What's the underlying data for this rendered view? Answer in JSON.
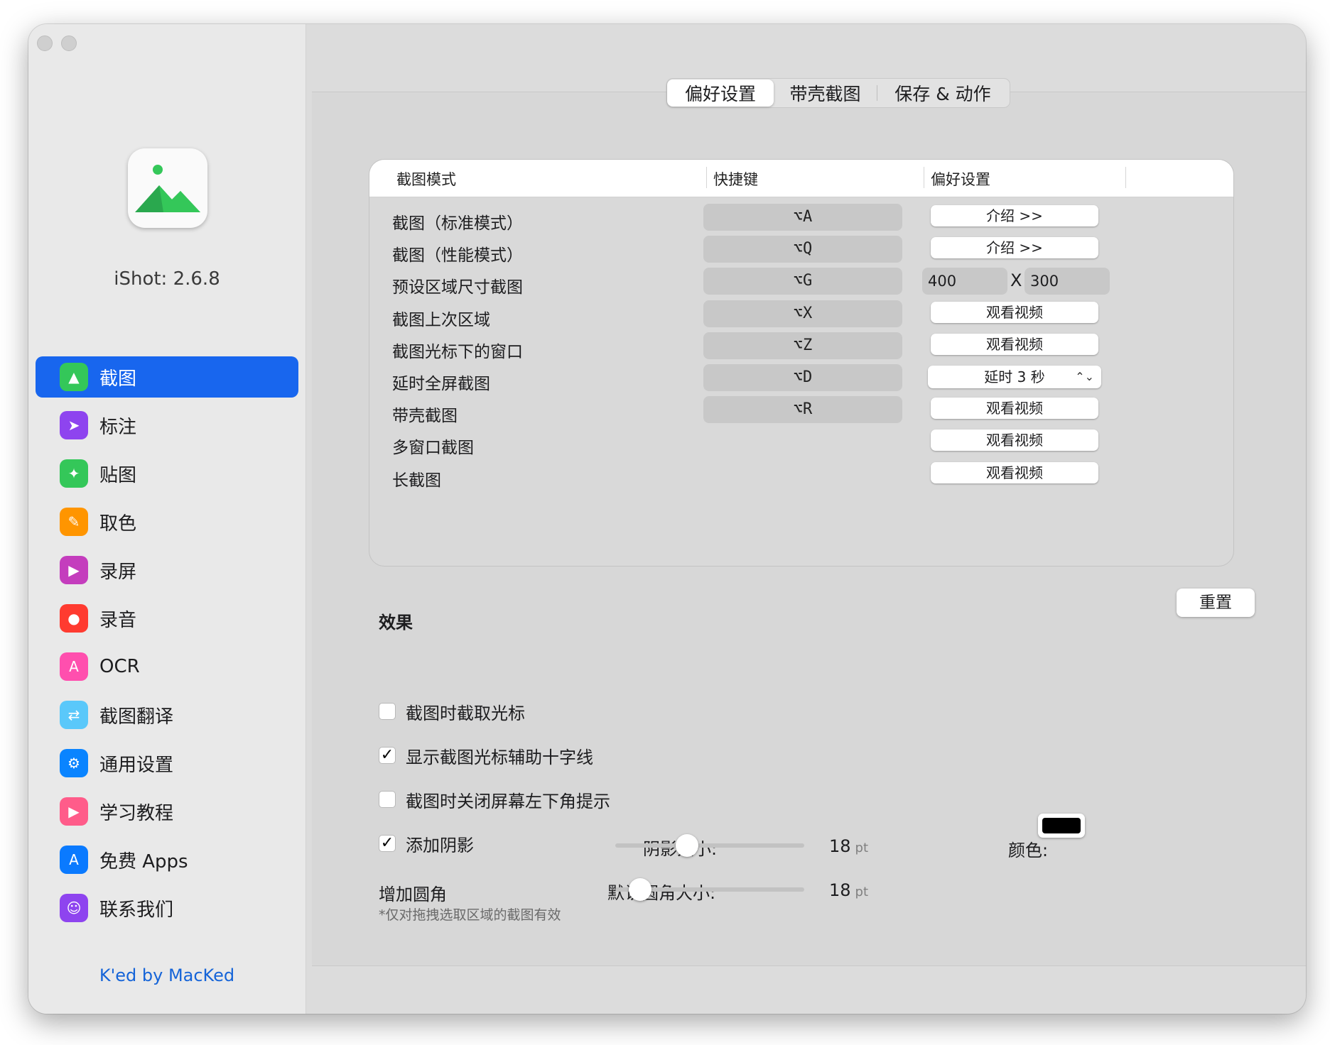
{
  "app": {
    "version_label": "iShot: 2.6.8",
    "credit": "K'ed by MacKed"
  },
  "sidebar": {
    "items": [
      {
        "label": "截图",
        "icon": "screenshot-icon",
        "color": "#34c759",
        "active": true
      },
      {
        "label": "标注",
        "icon": "cursor-icon",
        "color": "#8e44ef"
      },
      {
        "label": "贴图",
        "icon": "pin-icon",
        "color": "#34c759"
      },
      {
        "label": "取色",
        "icon": "eyedropper-icon",
        "color": "#ff9500"
      },
      {
        "label": "录屏",
        "icon": "record-screen-icon",
        "color": "#c43dbd"
      },
      {
        "label": "录音",
        "icon": "microphone-icon",
        "color": "#ff3b30"
      },
      {
        "label": "OCR",
        "icon": "ocr-icon",
        "color": "#ff4fae"
      },
      {
        "label": "截图翻译",
        "icon": "translate-icon",
        "color": "#5ac8fa"
      },
      {
        "label": "通用设置",
        "icon": "gear-icon",
        "color": "#0a84ff"
      },
      {
        "label": "学习教程",
        "icon": "tutorial-icon",
        "color": "#ff5c8a"
      },
      {
        "label": "免费 Apps",
        "icon": "app-store-icon",
        "color": "#0a7aff"
      },
      {
        "label": "联系我们",
        "icon": "contacts-icon",
        "color": "#8e44ef"
      }
    ]
  },
  "tabs": [
    {
      "label": "偏好设置",
      "active": true
    },
    {
      "label": "带壳截图"
    },
    {
      "label": "保存 & 动作"
    }
  ],
  "table": {
    "headers": [
      "截图模式",
      "快捷键",
      "偏好设置"
    ],
    "rows": [
      {
        "label": "截图（标准模式）",
        "shortcut": "⌥A",
        "pref_type": "button",
        "pref": "介绍 >>"
      },
      {
        "label": "截图（性能模式）",
        "shortcut": "⌥Q",
        "pref_type": "button",
        "pref": "介绍 >>"
      },
      {
        "label": "预设区域尺寸截图",
        "shortcut": "⌥G",
        "pref_type": "size",
        "width": "400",
        "sep": "X",
        "height": "300"
      },
      {
        "label": "截图上次区域",
        "shortcut": "⌥X",
        "pref_type": "button",
        "pref": "观看视频"
      },
      {
        "label": "截图光标下的窗口",
        "shortcut": "⌥Z",
        "pref_type": "button",
        "pref": "观看视频"
      },
      {
        "label": "延时全屏截图",
        "shortcut": "⌥D",
        "pref_type": "select",
        "pref": "延时 3 秒"
      },
      {
        "label": "带壳截图",
        "shortcut": "⌥R",
        "pref_type": "button",
        "pref": "观看视频"
      },
      {
        "label": "多窗口截图",
        "shortcut": "",
        "pref_type": "button",
        "pref": "观看视频"
      },
      {
        "label": "长截图",
        "shortcut": "",
        "pref_type": "button",
        "pref": "观看视频"
      }
    ]
  },
  "reset_label": "重置",
  "effects": {
    "title": "效果",
    "options": [
      {
        "label": "截图时截取光标",
        "checked": false
      },
      {
        "label": "显示截图光标辅助十字线",
        "checked": true
      },
      {
        "label": "截图时关闭屏幕左下角提示",
        "checked": false
      },
      {
        "label": "添加阴影",
        "checked": true
      }
    ],
    "shadow_size": {
      "label": "阴影大小:",
      "value": "18",
      "unit": "pt",
      "fraction": 0.38
    },
    "color": {
      "label": "颜色:",
      "value": "#000000"
    },
    "corner": {
      "label": "增加圆角",
      "size_label": "默认圆角大小:",
      "value": "18",
      "unit": "pt",
      "fraction": 0.13
    },
    "note": "*仅对拖拽选取区域的截图有效"
  }
}
